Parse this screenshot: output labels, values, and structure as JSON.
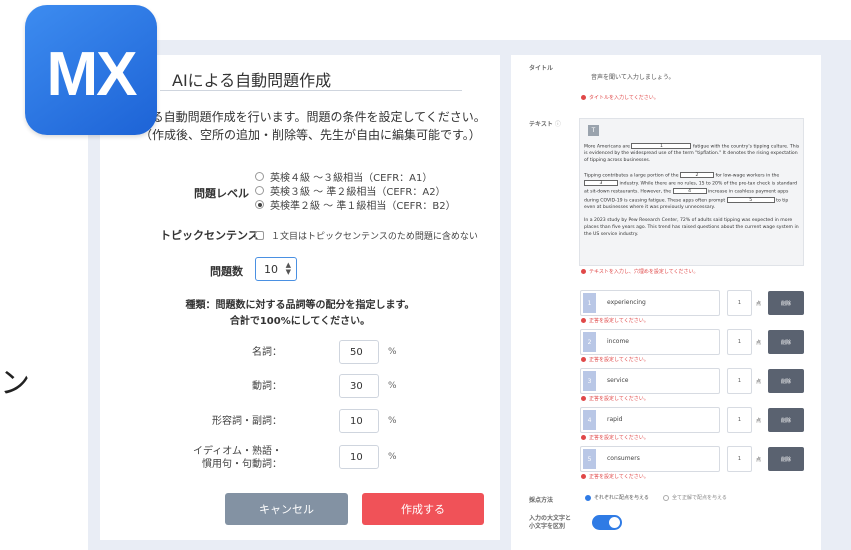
{
  "logo": {
    "text": "MX"
  },
  "stray_glyph": "ン",
  "left_panel": {
    "title": "AIによる自動問題作成",
    "description": [
      "よる自動問題作成を行います。問題の条件を設定してください。",
      "（作成後、空所の追加・削除等、先生が自由に編集可能です。）"
    ],
    "level_label": "問題レベル",
    "levels": [
      {
        "label": "英検４級 ～３級相当（CEFR：A1）",
        "selected": false
      },
      {
        "label": "英検３級 ～ 準２級相当（CEFR：A2）",
        "selected": false
      },
      {
        "label": "英検準２級 ～ 準１級相当（CEFR：B2）",
        "selected": true
      }
    ],
    "topic_label": "トピックセンテンス",
    "topic_option": "１文目はトピックセンテンスのため問題に含めない",
    "count_label": "問題数",
    "count_value": "10",
    "dist_title_1": "種類：問題数に対する品詞等の配分を指定します。",
    "dist_title_2": "合計で100%にしてください。",
    "pos": [
      {
        "label_1": "名詞：",
        "label_2": "",
        "value": "50",
        "unit": "%"
      },
      {
        "label_1": "動詞：",
        "label_2": "",
        "value": "30",
        "unit": "%"
      },
      {
        "label_1": "形容詞・副詞：",
        "label_2": "",
        "value": "10",
        "unit": "%"
      },
      {
        "label_1": "イディオム・熟語・",
        "label_2": "慣用句・句動詞：",
        "value": "10",
        "unit": "%"
      }
    ],
    "cancel_label": "キャンセル",
    "create_label": "作成する"
  },
  "right_panel": {
    "title_label": "タイトル",
    "title_placeholder": "音声を聞いて入力しましょう。",
    "title_error": "タイトルを入力してください。",
    "text_label": "テキスト",
    "editor_button": "T",
    "passage": {
      "p1_a": "More Americans are",
      "b1": "1",
      "p1_b": "fatigue with the country's tipping culture. This is evidenced by the widespread use of the term \"tipflation.\" It denotes the rising expectation of tipping across businesses.",
      "p2_a": "Tipping contributes a large portion of the",
      "b2": "2",
      "p2_b": "for low-wage workers in the",
      "b3": "3",
      "p2_c": "industry. While there are no rules, 15 to 20% of the pre-tax check is standard at sit-down restaurants. However, the",
      "b4": "4",
      "p2_d": "increase in cashless payment apps during COVID-19 is causing fatigue. These apps often prompt",
      "b5": "5",
      "p2_e": "to tip even at businesses where it was previously unnecessary.",
      "p3": "In a 2023 study by Pew Research Center, 72% of adults said tipping was expected in more places than five years ago. This trend has raised questions about the current wage system in the US service industry."
    },
    "text_error": "テキストを入力し、穴埋めを設定してください。",
    "answers": [
      {
        "num": "1",
        "word": "experiencing",
        "points": "1",
        "unit": "点",
        "delete": "削除",
        "error": "正答を設定してください。"
      },
      {
        "num": "2",
        "word": "income",
        "points": "1",
        "unit": "点",
        "delete": "削除",
        "error": "正答を設定してください。"
      },
      {
        "num": "3",
        "word": "service",
        "points": "1",
        "unit": "点",
        "delete": "削除",
        "error": "正答を設定してください。"
      },
      {
        "num": "4",
        "word": "rapid",
        "points": "1",
        "unit": "点",
        "delete": "削除",
        "error": "正答を設定してください。"
      },
      {
        "num": "5",
        "word": "consumers",
        "points": "1",
        "unit": "点",
        "delete": "削除",
        "error": "正答を設定してください。"
      }
    ],
    "scoring_label": "採点方法",
    "scoring_options": [
      "それぞれに配点を与える",
      "全て正解で配点を与える"
    ],
    "case_label_1": "入力の大文字と",
    "case_label_2": "小文字を区別",
    "case_toggle": true
  }
}
